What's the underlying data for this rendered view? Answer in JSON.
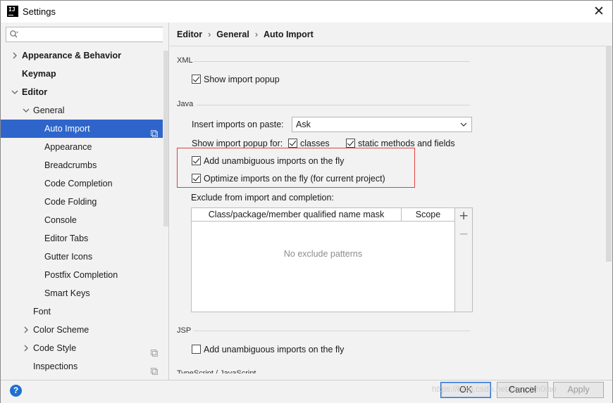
{
  "window": {
    "title": "Settings",
    "app_icon_text": "IJ",
    "close_glyph": "✕"
  },
  "search": {
    "placeholder": "",
    "value": ""
  },
  "sidebar": {
    "items": [
      {
        "label": "Appearance & Behavior",
        "bold": true,
        "level": 0,
        "arrow": "collapsed"
      },
      {
        "label": "Keymap",
        "bold": true,
        "level": 0,
        "arrow": "none"
      },
      {
        "label": "Editor",
        "bold": true,
        "level": 0,
        "arrow": "expanded"
      },
      {
        "label": "General",
        "bold": false,
        "level": 1,
        "arrow": "expanded"
      },
      {
        "label": "Auto Import",
        "bold": false,
        "level": 2,
        "arrow": "none",
        "selected": true,
        "copy_icon": true
      },
      {
        "label": "Appearance",
        "bold": false,
        "level": 2,
        "arrow": "none"
      },
      {
        "label": "Breadcrumbs",
        "bold": false,
        "level": 2,
        "arrow": "none"
      },
      {
        "label": "Code Completion",
        "bold": false,
        "level": 2,
        "arrow": "none"
      },
      {
        "label": "Code Folding",
        "bold": false,
        "level": 2,
        "arrow": "none"
      },
      {
        "label": "Console",
        "bold": false,
        "level": 2,
        "arrow": "none"
      },
      {
        "label": "Editor Tabs",
        "bold": false,
        "level": 2,
        "arrow": "none"
      },
      {
        "label": "Gutter Icons",
        "bold": false,
        "level": 2,
        "arrow": "none"
      },
      {
        "label": "Postfix Completion",
        "bold": false,
        "level": 2,
        "arrow": "none"
      },
      {
        "label": "Smart Keys",
        "bold": false,
        "level": 2,
        "arrow": "none"
      },
      {
        "label": "Font",
        "bold": false,
        "level": 1,
        "arrow": "none"
      },
      {
        "label": "Color Scheme",
        "bold": false,
        "level": 1,
        "arrow": "collapsed"
      },
      {
        "label": "Code Style",
        "bold": false,
        "level": 1,
        "arrow": "collapsed",
        "copy_icon": true
      },
      {
        "label": "Inspections",
        "bold": false,
        "level": 1,
        "arrow": "none",
        "copy_icon": true
      }
    ]
  },
  "breadcrumb": {
    "items": [
      "Editor",
      "General",
      "Auto Import"
    ],
    "separator": "›"
  },
  "xml_section": {
    "title": "XML",
    "show_import_popup": {
      "label": "Show import popup",
      "checked": true
    }
  },
  "java_section": {
    "title": "Java",
    "insert_on_paste_label": "Insert imports on paste:",
    "insert_on_paste_value": "Ask",
    "show_popup_for_label": "Show import popup for:",
    "classes": {
      "label": "classes",
      "checked": true
    },
    "static_methods": {
      "label": "static methods and fields",
      "checked": true
    },
    "add_unambiguous": {
      "label": "Add unambiguous imports on the fly",
      "checked": true
    },
    "optimize_imports": {
      "label": "Optimize imports on the fly (for current project)",
      "checked": true
    },
    "exclude_label": "Exclude from import and completion:",
    "table": {
      "columns": [
        "Class/package/member qualified name mask",
        "Scope"
      ],
      "empty_text": "No exclude patterns",
      "add_glyph": "+",
      "remove_glyph": "−"
    }
  },
  "jsp_section": {
    "title": "JSP",
    "add_unambiguous": {
      "label": "Add unambiguous imports on the fly",
      "checked": false
    }
  },
  "next_section_title": "TypeScript / JavaScript",
  "buttons": {
    "ok": "OK",
    "cancel": "Cancel",
    "apply": "Apply",
    "help": "?"
  },
  "watermark": "https://blog.csdn.net/pan_1th0iao",
  "colors": {
    "selection": "#2f65ca",
    "highlight_box": "#e04040",
    "help_icon": "#1f6fd0"
  }
}
